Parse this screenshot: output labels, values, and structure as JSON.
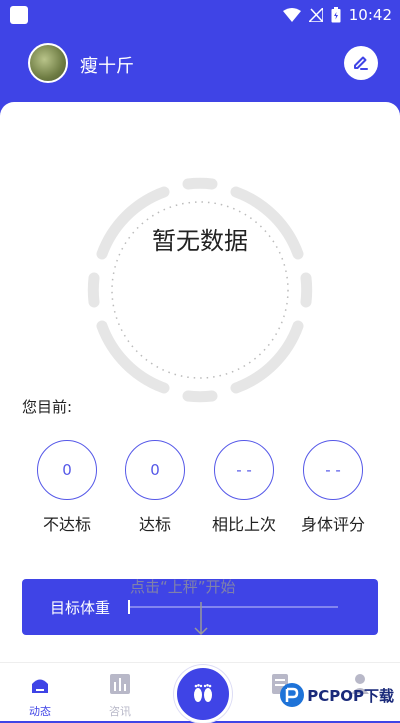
{
  "status_bar": {
    "time": "10:42"
  },
  "header": {
    "username": "瘦十斤"
  },
  "main": {
    "no_data_text": "暂无数据",
    "current_label": "您目前:",
    "stats": [
      {
        "value": "0",
        "label": "不达标"
      },
      {
        "value": "0",
        "label": "达标"
      },
      {
        "value": "- -",
        "label": "相比上次"
      },
      {
        "value": "- -",
        "label": "身体评分"
      }
    ],
    "target_label": "目标体重",
    "hint": "点击“上秤”开始"
  },
  "bottom_nav": {
    "items": [
      {
        "label": "动态",
        "icon": "home-icon"
      },
      {
        "label": "咨讯",
        "icon": "chart-icon"
      },
      {
        "label": "",
        "icon": "footprints-icon"
      },
      {
        "label": "",
        "icon": "document-icon"
      },
      {
        "label": "",
        "icon": "person-icon"
      }
    ]
  },
  "watermark": {
    "text": "PCPOP下载"
  },
  "colors": {
    "accent": "#3F44E6",
    "active_nav": "#3F44E6",
    "inactive_nav": "#b8b8c8"
  }
}
